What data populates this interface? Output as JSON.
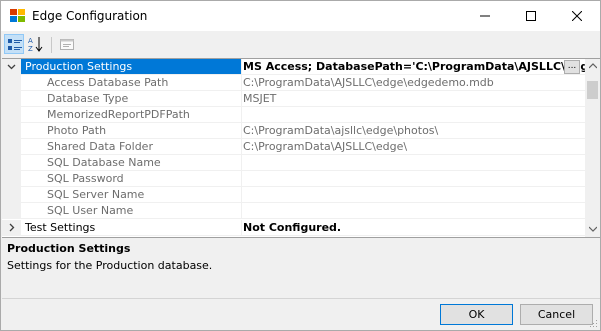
{
  "window": {
    "title": "Edge Configuration",
    "icon": "app-icon"
  },
  "toolbar": {
    "items": [
      "categorized-icon",
      "alphabetical-icon",
      "property-pages-icon"
    ]
  },
  "grid": {
    "rows": [
      {
        "name": "Production Settings",
        "value": "MS Access; DatabasePath='C:\\ProgramData\\AJSLLC\\edge\\edgedemo.mdb'",
        "type": "category",
        "expanded": true,
        "selected": true
      },
      {
        "name": "Access Database Path",
        "value": "C:\\ProgramData\\AJSLLC\\edge\\edgedemo.mdb"
      },
      {
        "name": "Database Type",
        "value": "MSJET"
      },
      {
        "name": "MemorizedReportPDFPath",
        "value": ""
      },
      {
        "name": "Photo Path",
        "value": "C:\\ProgramData\\ajsllc\\edge\\photos\\"
      },
      {
        "name": "Shared Data Folder",
        "value": "C:\\ProgramData\\AJSLLC\\edge\\"
      },
      {
        "name": "SQL Database Name",
        "value": ""
      },
      {
        "name": "SQL Password",
        "value": ""
      },
      {
        "name": "SQL Server Name",
        "value": ""
      },
      {
        "name": "SQL User Name",
        "value": ""
      },
      {
        "name": "Test Settings",
        "value": "Not Configured.",
        "type": "category",
        "expanded": false
      }
    ],
    "ellipsis": "..."
  },
  "description": {
    "title": "Production Settings",
    "text": "Settings for the Production database."
  },
  "buttons": {
    "ok": "OK",
    "cancel": "Cancel"
  }
}
